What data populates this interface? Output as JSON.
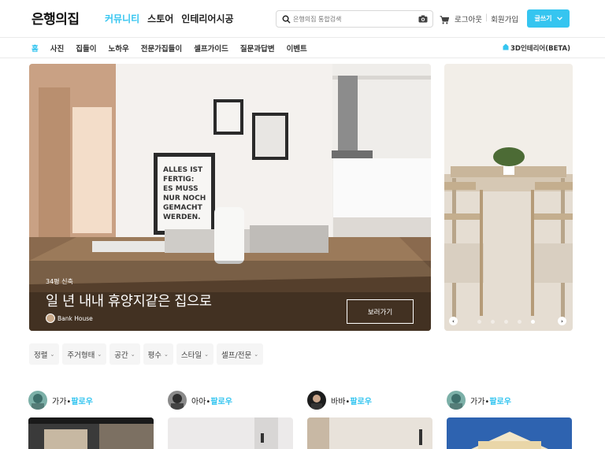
{
  "header": {
    "logo": "은행의집",
    "nav": [
      {
        "label": "커뮤니티",
        "active": true
      },
      {
        "label": "스토어",
        "active": false
      },
      {
        "label": "인테리어시공",
        "active": false
      }
    ],
    "search_placeholder": "은행의집 통합검색",
    "logout": "로그아웃",
    "signup": "회원가입",
    "write": "글쓰기"
  },
  "subnav": {
    "items": [
      {
        "label": "홈",
        "active": true
      },
      {
        "label": "사진",
        "active": false
      },
      {
        "label": "집들이",
        "active": false
      },
      {
        "label": "노하우",
        "active": false
      },
      {
        "label": "전문가집들이",
        "active": false
      },
      {
        "label": "셀프가이드",
        "active": false
      },
      {
        "label": "질문과답변",
        "active": false
      },
      {
        "label": "이벤트",
        "active": false
      }
    ],
    "beta": "3D인테리어(BETA)"
  },
  "hero": {
    "kicker": "34평 신축",
    "title": "일 년 내내 휴양지같은 집으로",
    "author": "Bank House",
    "button": "보러가기",
    "poster_text": "ALLES IST FERTIG: ES MUSS NUR NOCH GEMACHT WERDEN."
  },
  "side_carousel": {
    "dots": 5,
    "active_dot": 4
  },
  "filters": [
    {
      "label": "정렬"
    },
    {
      "label": "주거형태"
    },
    {
      "label": "공간"
    },
    {
      "label": "평수"
    },
    {
      "label": "스타일"
    },
    {
      "label": "셀프/전문"
    }
  ],
  "cards": [
    {
      "user": "가가",
      "follow": "팔로우"
    },
    {
      "user": "아아",
      "follow": "팔로우"
    },
    {
      "user": "바바",
      "follow": "팔로우"
    },
    {
      "user": "가가",
      "follow": "팔로우"
    }
  ],
  "colors": {
    "accent": "#35c5f0",
    "text": "#222222",
    "filter_bg": "#f5f5f5"
  }
}
